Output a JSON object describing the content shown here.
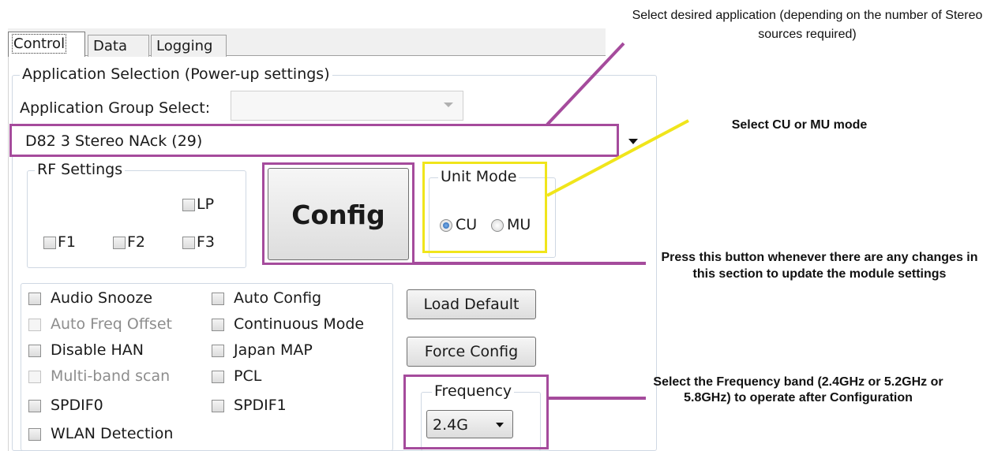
{
  "tabs": [
    {
      "label": "Control",
      "active": true
    },
    {
      "label": "Data",
      "active": false
    },
    {
      "label": "Logging",
      "active": false
    }
  ],
  "app_selection": {
    "legend": "Application Selection (Power-up settings)",
    "group_select_label": "Application Group Select:",
    "group_select_value": "",
    "application_value": "D82  3 Stereo NAck (29)"
  },
  "rf_settings": {
    "legend": "RF Settings",
    "checkboxes": [
      "LP",
      "F1",
      "F2",
      "F3"
    ]
  },
  "config_button": "Config",
  "unit_mode": {
    "legend": "Unit Mode",
    "options": [
      {
        "label": "CU",
        "selected": true
      },
      {
        "label": "MU",
        "selected": false
      }
    ]
  },
  "options": [
    {
      "label": "Audio Snooze",
      "enabled": true,
      "checked": false
    },
    {
      "label": "Auto Config",
      "enabled": true,
      "checked": false
    },
    {
      "label": "Auto Freq Offset",
      "enabled": false,
      "checked": false
    },
    {
      "label": "Continuous Mode",
      "enabled": true,
      "checked": false
    },
    {
      "label": "Disable HAN",
      "enabled": true,
      "checked": false
    },
    {
      "label": "Japan MAP",
      "enabled": true,
      "checked": false
    },
    {
      "label": "Multi-band scan",
      "enabled": false,
      "checked": false
    },
    {
      "label": "PCL",
      "enabled": true,
      "checked": false
    },
    {
      "label": "SPDIF0",
      "enabled": true,
      "checked": false
    },
    {
      "label": "SPDIF1",
      "enabled": true,
      "checked": false
    },
    {
      "label": "WLAN Detection",
      "enabled": true,
      "checked": false
    }
  ],
  "load_default_button": "Load Default",
  "force_config_button": "Force Config",
  "frequency": {
    "legend": "Frequency",
    "value": "2.4G"
  },
  "annotations": {
    "application": "Select desired application (depending on the number of Stereo sources required)",
    "unit_mode": "Select CU or MU mode",
    "config": "Press this button whenever there are any changes in this section to update the module settings",
    "frequency": "Select the Frequency band (2.4GHz or 5.2GHz or 5.8GHz) to operate after Configuration"
  },
  "colors": {
    "magenta_highlight": "#a54b9c",
    "yellow_highlight": "#f0e51b",
    "group_border": "#cfd8e3"
  }
}
